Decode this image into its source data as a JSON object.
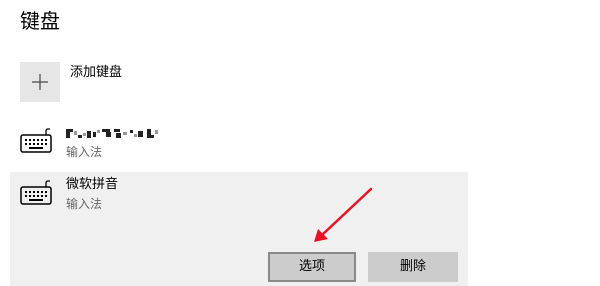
{
  "section": {
    "title": "键盘"
  },
  "add_keyboard": {
    "label": "添加键盘",
    "icon": "plus-icon"
  },
  "keyboards": [
    {
      "name_redacted": true,
      "type": "输入法",
      "icon": "keyboard-icon"
    },
    {
      "name": "微软拼音",
      "type": "输入法",
      "icon": "keyboard-icon",
      "selected": true
    }
  ],
  "actions": {
    "options_label": "选项",
    "remove_label": "删除"
  },
  "annotation": {
    "arrow_color": "#e81123"
  },
  "colors": {
    "selected_background": "#f0f0f0",
    "button_background": "#cccccc",
    "add_tile_background": "#e6e6e6"
  }
}
